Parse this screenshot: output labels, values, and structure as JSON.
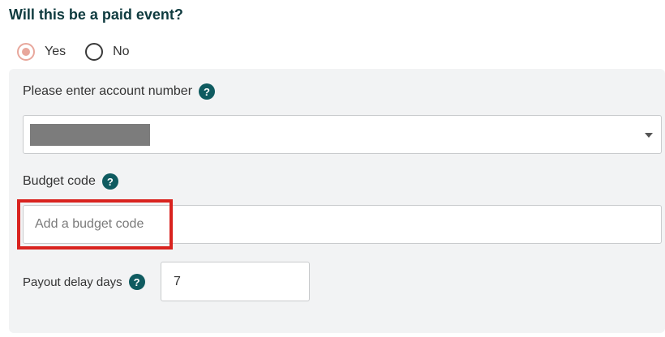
{
  "question": "Will this be a paid event?",
  "paid_event": {
    "options": [
      {
        "label": "Yes",
        "selected": true
      },
      {
        "label": "No",
        "selected": false
      }
    ]
  },
  "account_number": {
    "label": "Please enter account number",
    "help_icon": "question-circle-icon",
    "value": ""
  },
  "budget_code": {
    "label": "Budget code",
    "help_icon": "question-circle-icon",
    "placeholder": "Add a budget code",
    "value": ""
  },
  "payout_delay": {
    "label": "Payout delay days",
    "help_icon": "question-circle-icon",
    "value": "7"
  },
  "colors": {
    "heading": "#0f3b3f",
    "help_icon_bg": "#0f5b60",
    "radio_selected": "#e8a79c",
    "panel_bg": "#f2f3f4",
    "highlight_border": "#d9231f"
  }
}
